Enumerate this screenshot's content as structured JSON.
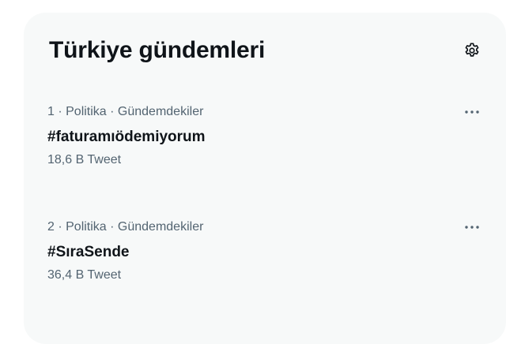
{
  "header": {
    "title": "Türkiye gündemleri",
    "settings_icon": "gear-icon"
  },
  "trends": [
    {
      "meta": "1 · Politika · Gündemdekiler",
      "name": "#faturamıödemiyorum",
      "count": "18,6 B Tweet",
      "more_icon": "more-horizontal-icon"
    },
    {
      "meta": "2 · Politika · Gündemdekiler",
      "name": "#SıraSende",
      "count": "36,4 B Tweet",
      "more_icon": "more-horizontal-icon"
    }
  ],
  "colors": {
    "panel_bg": "#f7f9f9",
    "primary_text": "#0f1419",
    "secondary_text": "#536471"
  }
}
